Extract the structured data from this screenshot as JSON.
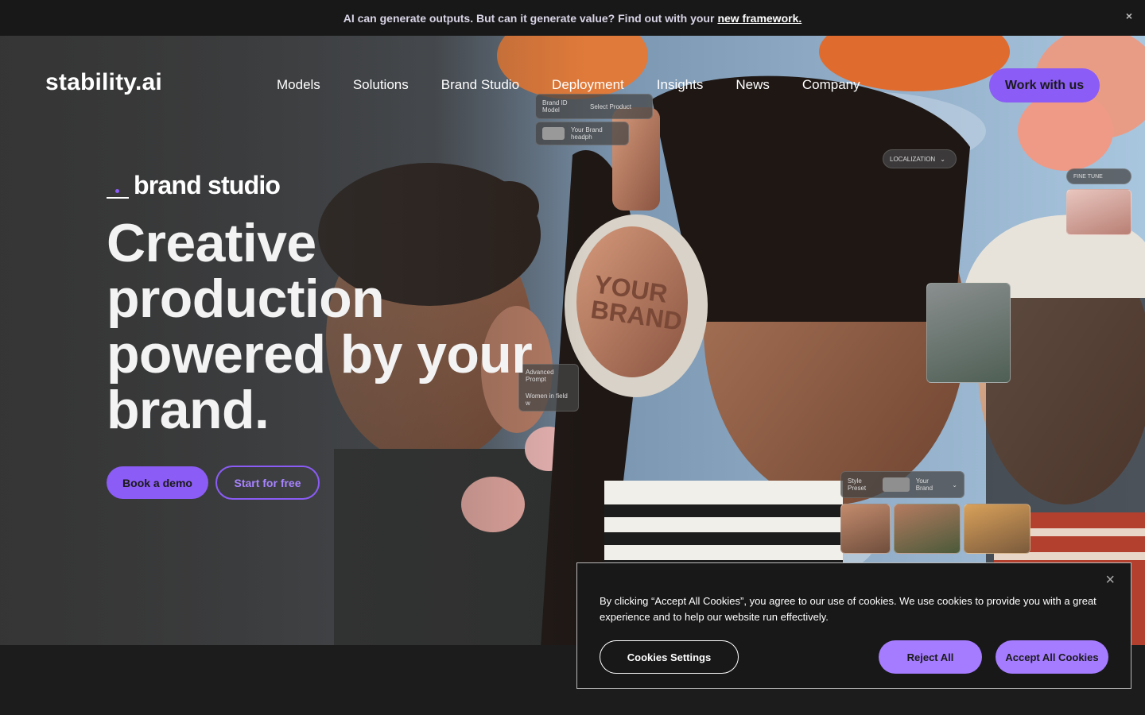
{
  "announcement": {
    "text": "AI can generate outputs. But can it generate value? Find out with your",
    "link": "new framework.",
    "close": "×"
  },
  "header": {
    "logo": "stability.ai",
    "nav": [
      "Models",
      "Solutions",
      "Brand Studio",
      "Deployment",
      "Insights",
      "News",
      "Company"
    ],
    "cta": "Work with us"
  },
  "hero": {
    "eyebrow": "brand studio",
    "headline": "Creative production powered by your brand.",
    "primary_button": "Book a demo",
    "secondary_button": "Start for free",
    "overlay_labels": {
      "brand_model": "Brand ID Model",
      "select_product": "Select Product",
      "your_brand_headphones": "Your Brand headph",
      "localization": "LOCALIZATION",
      "fine_tune": "FINE TUNE",
      "advanced_prompt": "Advanced Prompt",
      "prompt_text": "Women in field w",
      "style_preset": "Style Preset",
      "your_brand": "Your Brand",
      "headphone_logo": "YOUR BRAND"
    }
  },
  "cookie_banner": {
    "text": "By clicking “Accept All Cookies”, you agree to our use of cookies. We use cookies to provide you with a great experience and to help our website run effectively.",
    "settings_button": "Cookies Settings",
    "reject_button": "Reject All",
    "accept_button": "Accept All Cookies",
    "close": "×"
  },
  "colors": {
    "accent": "#8b5cf6",
    "accent_light": "#a57cff",
    "background": "#1c1c1c"
  }
}
